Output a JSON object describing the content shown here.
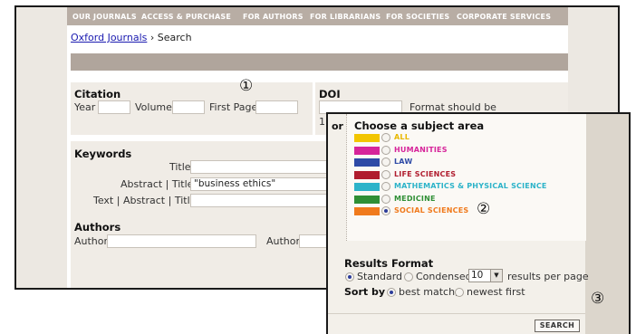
{
  "nav": [
    "OUR JOURNALS",
    "ACCESS & PURCHASE",
    "FOR AUTHORS",
    "FOR LIBRARIANS",
    "FOR SOCIETIES",
    "CORPORATE SERVICES"
  ],
  "breadcrumb": {
    "link": "Oxford Journals",
    "sep": "›",
    "current": "Search"
  },
  "markers": [
    "①",
    "②",
    "③"
  ],
  "citation": {
    "title": "Citation",
    "year_label": "Year",
    "volume_label": "Volume",
    "first_page_label": "First Page"
  },
  "doi": {
    "title": "DOI",
    "hint": "Format should be",
    "partial_prefix": "1"
  },
  "keywords": {
    "title": "Keywords",
    "title_label": "Title",
    "abstract_title_label": "Abstract | Title",
    "abstract_title_value": "\"business ethics\"",
    "text_abstract_title_label": "Text | Abstract | Title"
  },
  "authors": {
    "title": "Authors",
    "author_label_1": "Author",
    "author_label_2": "Author"
  },
  "subject": {
    "or": "or",
    "title": "Choose a subject area",
    "items": [
      {
        "label": "ALL",
        "color": "#f2c500",
        "text_color": "#e8b800"
      },
      {
        "label": "HUMANITIES",
        "color": "#d6249a",
        "text_color": "#d6249a"
      },
      {
        "label": "LAW",
        "color": "#2e4aa6",
        "text_color": "#2e4aa6"
      },
      {
        "label": "LIFE SCIENCES",
        "color": "#b01c2e",
        "text_color": "#b01c2e"
      },
      {
        "label": "MATHEMATICS & PHYSICAL SCIENCE",
        "color": "#2cb3c9",
        "text_color": "#2cb3c9"
      },
      {
        "label": "MEDICINE",
        "color": "#2f8f35",
        "text_color": "#2f8f35"
      },
      {
        "label": "SOCIAL SCIENCES",
        "color": "#f07a1c",
        "text_color": "#f07a1c"
      }
    ],
    "selected": "SOCIAL SCIENCES"
  },
  "results": {
    "title": "Results Format",
    "standard": "Standard",
    "condensed": "Condensed",
    "per_page_value": "10",
    "per_page_suffix": "results per page",
    "sort_label": "Sort by",
    "sort_best": "best match,",
    "sort_newest": "newest first"
  },
  "search_button": "SEARCH"
}
